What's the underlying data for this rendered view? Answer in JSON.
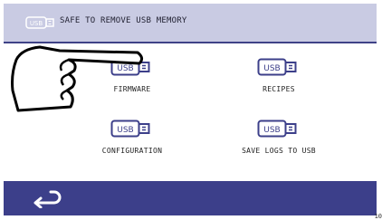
{
  "header": {
    "usb_icon_text": "USB",
    "title": "SAFE TO REMOVE USB MEMORY"
  },
  "tiles": [
    {
      "icon_text": "USB",
      "label": "FIRMWARE"
    },
    {
      "icon_text": "USB",
      "label": "RECIPES"
    },
    {
      "icon_text": "USB",
      "label": "CONFIGURATION"
    },
    {
      "icon_text": "USB",
      "label": "SAVE LOGS TO USB"
    }
  ],
  "footer": {
    "back_icon": "back-arrow-icon"
  },
  "overlay": {
    "hand_icon": "pointing-hand-icon"
  },
  "corner_number": "10",
  "colors": {
    "header_bg": "#c9cbe3",
    "footer_bg": "#3c3f8a",
    "icon_outline": "#3c3f8a",
    "header_icon_outline": "#ffffff"
  }
}
